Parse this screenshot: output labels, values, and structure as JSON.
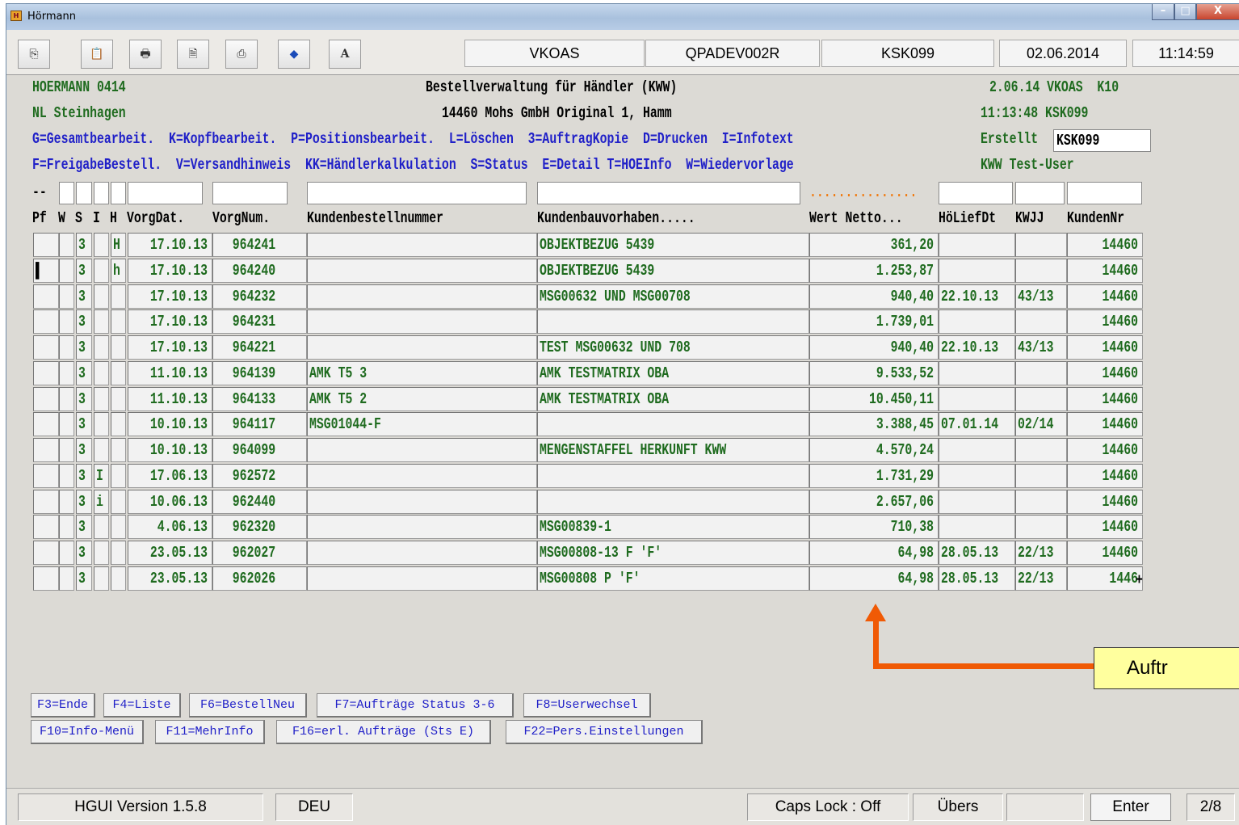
{
  "window": {
    "title": "Hörmann",
    "icon": "hormann-logo-icon",
    "min": "–",
    "max": "□",
    "close": "X"
  },
  "toolbar": {
    "buttons": [
      {
        "icon": "copy-icon",
        "glyph": "⎘"
      },
      {
        "icon": "paste-icon",
        "glyph": "📋"
      },
      {
        "icon": "print-icon",
        "glyph": "🖶"
      },
      {
        "icon": "print-preview-icon",
        "glyph": "🗎"
      },
      {
        "icon": "print-screen-icon",
        "glyph": "⎙"
      },
      {
        "icon": "diamond-icon",
        "glyph": "◆"
      },
      {
        "icon": "font-icon",
        "glyph": "A"
      }
    ],
    "user": "VKOAS",
    "program": "QPADEV002R",
    "terminal": "KSK099",
    "date": "02.06.2014",
    "time": "11:14:59"
  },
  "header": {
    "company": "HOERMANN 0414",
    "branch": "NL Steinhagen",
    "title": "Bestellverwaltung für Händler (KWW)",
    "customer": "14460 Mohs GmbH Original 1, Hamm",
    "date_user": "2.06.14 VKOAS  K10",
    "time_terminal": "11:13:48 KSK099",
    "options1": "G=Gesamtbearbeit.  K=Kopfbearbeit.  P=Positionsbearbeit.  L=Löschen  3=AuftragKopie  D=Drucken  I=Infotext",
    "options2": "F=FreigabeBestell.  V=Versandhinweis  KK=Händlerkalkulation  S=Status  E=Detail T=HOEInfo  W=Wiedervorlage",
    "created_label": "Erstellt",
    "created_value": "KSK099",
    "user_name": "KWW Test-User",
    "filter_marker": "--",
    "filter_dots": "..............."
  },
  "columns": {
    "pf": "Pf",
    "w": "W",
    "s": "S",
    "i": "I",
    "h": "H",
    "vorgdat": "VorgDat.",
    "vorgnum": "VorgNum.",
    "bestellnr": "Kundenbestellnummer",
    "bauvorhaben": "Kundenbauvorhaben.....",
    "wert": "Wert Netto...",
    "liefdt": "HöLiefDt",
    "kwjj": "KWJJ",
    "kundennr": "KundenNr"
  },
  "rows": [
    {
      "pf": "",
      "s": "3",
      "i": "",
      "h": "H",
      "date": "17.10.13",
      "num": "964241",
      "order": "",
      "project": "OBJEKTBEZUG 5439",
      "value": "361,20",
      "liefdt": "",
      "kwjj": "",
      "cust": "14460"
    },
    {
      "pf": "▌",
      "s": "3",
      "i": "",
      "h": "h",
      "date": "17.10.13",
      "num": "964240",
      "order": "",
      "project": "OBJEKTBEZUG 5439",
      "value": "1.253,87",
      "liefdt": "",
      "kwjj": "",
      "cust": "14460"
    },
    {
      "pf": "",
      "s": "3",
      "i": "",
      "h": "",
      "date": "17.10.13",
      "num": "964232",
      "order": "",
      "project": "MSG00632 UND MSG00708",
      "value": "940,40",
      "liefdt": "22.10.13",
      "kwjj": "43/13",
      "cust": "14460"
    },
    {
      "pf": "",
      "s": "3",
      "i": "",
      "h": "",
      "date": "17.10.13",
      "num": "964231",
      "order": "",
      "project": "",
      "value": "1.739,01",
      "liefdt": "",
      "kwjj": "",
      "cust": "14460"
    },
    {
      "pf": "",
      "s": "3",
      "i": "",
      "h": "",
      "date": "17.10.13",
      "num": "964221",
      "order": "",
      "project": "TEST MSG00632 UND 708",
      "value": "940,40",
      "liefdt": "22.10.13",
      "kwjj": "43/13",
      "cust": "14460"
    },
    {
      "pf": "",
      "s": "3",
      "i": "",
      "h": "",
      "date": "11.10.13",
      "num": "964139",
      "order": "AMK T5 3",
      "project": "AMK TESTMATRIX OBA",
      "value": "9.533,52",
      "liefdt": "",
      "kwjj": "",
      "cust": "14460"
    },
    {
      "pf": "",
      "s": "3",
      "i": "",
      "h": "",
      "date": "11.10.13",
      "num": "964133",
      "order": "AMK T5 2",
      "project": "AMK TESTMATRIX OBA",
      "value": "10.450,11",
      "liefdt": "",
      "kwjj": "",
      "cust": "14460"
    },
    {
      "pf": "",
      "s": "3",
      "i": "",
      "h": "",
      "date": "10.10.13",
      "num": "964117",
      "order": "MSG01044-F",
      "project": "",
      "value": "3.388,45",
      "liefdt": "07.01.14",
      "kwjj": "02/14",
      "cust": "14460"
    },
    {
      "pf": "",
      "s": "3",
      "i": "",
      "h": "",
      "date": "10.10.13",
      "num": "964099",
      "order": "",
      "project": "MENGENSTAFFEL HERKUNFT KWW",
      "value": "4.570,24",
      "liefdt": "",
      "kwjj": "",
      "cust": "14460"
    },
    {
      "pf": "",
      "s": "3",
      "i": "I",
      "h": "",
      "date": "17.06.13",
      "num": "962572",
      "order": "",
      "project": "",
      "value": "1.731,29",
      "liefdt": "",
      "kwjj": "",
      "cust": "14460"
    },
    {
      "pf": "",
      "s": "3",
      "i": "i",
      "h": "",
      "date": "10.06.13",
      "num": "962440",
      "order": "",
      "project": "",
      "value": "2.657,06",
      "liefdt": "",
      "kwjj": "",
      "cust": "14460"
    },
    {
      "pf": "",
      "s": "3",
      "i": "",
      "h": "",
      "date": "4.06.13",
      "num": "962320",
      "order": "",
      "project": "MSG00839-1",
      "value": "710,38",
      "liefdt": "",
      "kwjj": "",
      "cust": "14460"
    },
    {
      "pf": "",
      "s": "3",
      "i": "",
      "h": "",
      "date": "23.05.13",
      "num": "962027",
      "order": "",
      "project": "MSG00808-13 F 'F'",
      "value": "64,98",
      "liefdt": "28.05.13",
      "kwjj": "22/13",
      "cust": "14460"
    },
    {
      "pf": "",
      "s": "3",
      "i": "",
      "h": "",
      "date": "23.05.13",
      "num": "962026",
      "order": "",
      "project": "MSG00808 P 'F'",
      "value": "64,98",
      "liefdt": "28.05.13",
      "kwjj": "22/13",
      "cust": "1446"
    }
  ],
  "more_indicator": "+",
  "fkeys_row1": [
    "F3=Ende",
    "F4=Liste",
    "F6=BestellNeu",
    "F7=Aufträge Status 3-6",
    "F8=Userwechsel"
  ],
  "fkeys_row2": [
    "F10=Info-Menü",
    "F11=MehrInfo",
    "F16=erl. Aufträge (Sts E)",
    "F22=Pers.Einstellungen"
  ],
  "callout": "Auftr",
  "status": {
    "version": "HGUI Version 1.5.8",
    "lang": "DEU",
    "caps": "Caps Lock : Off",
    "mode": "Übers",
    "key": "Enter",
    "page": "2/8"
  }
}
